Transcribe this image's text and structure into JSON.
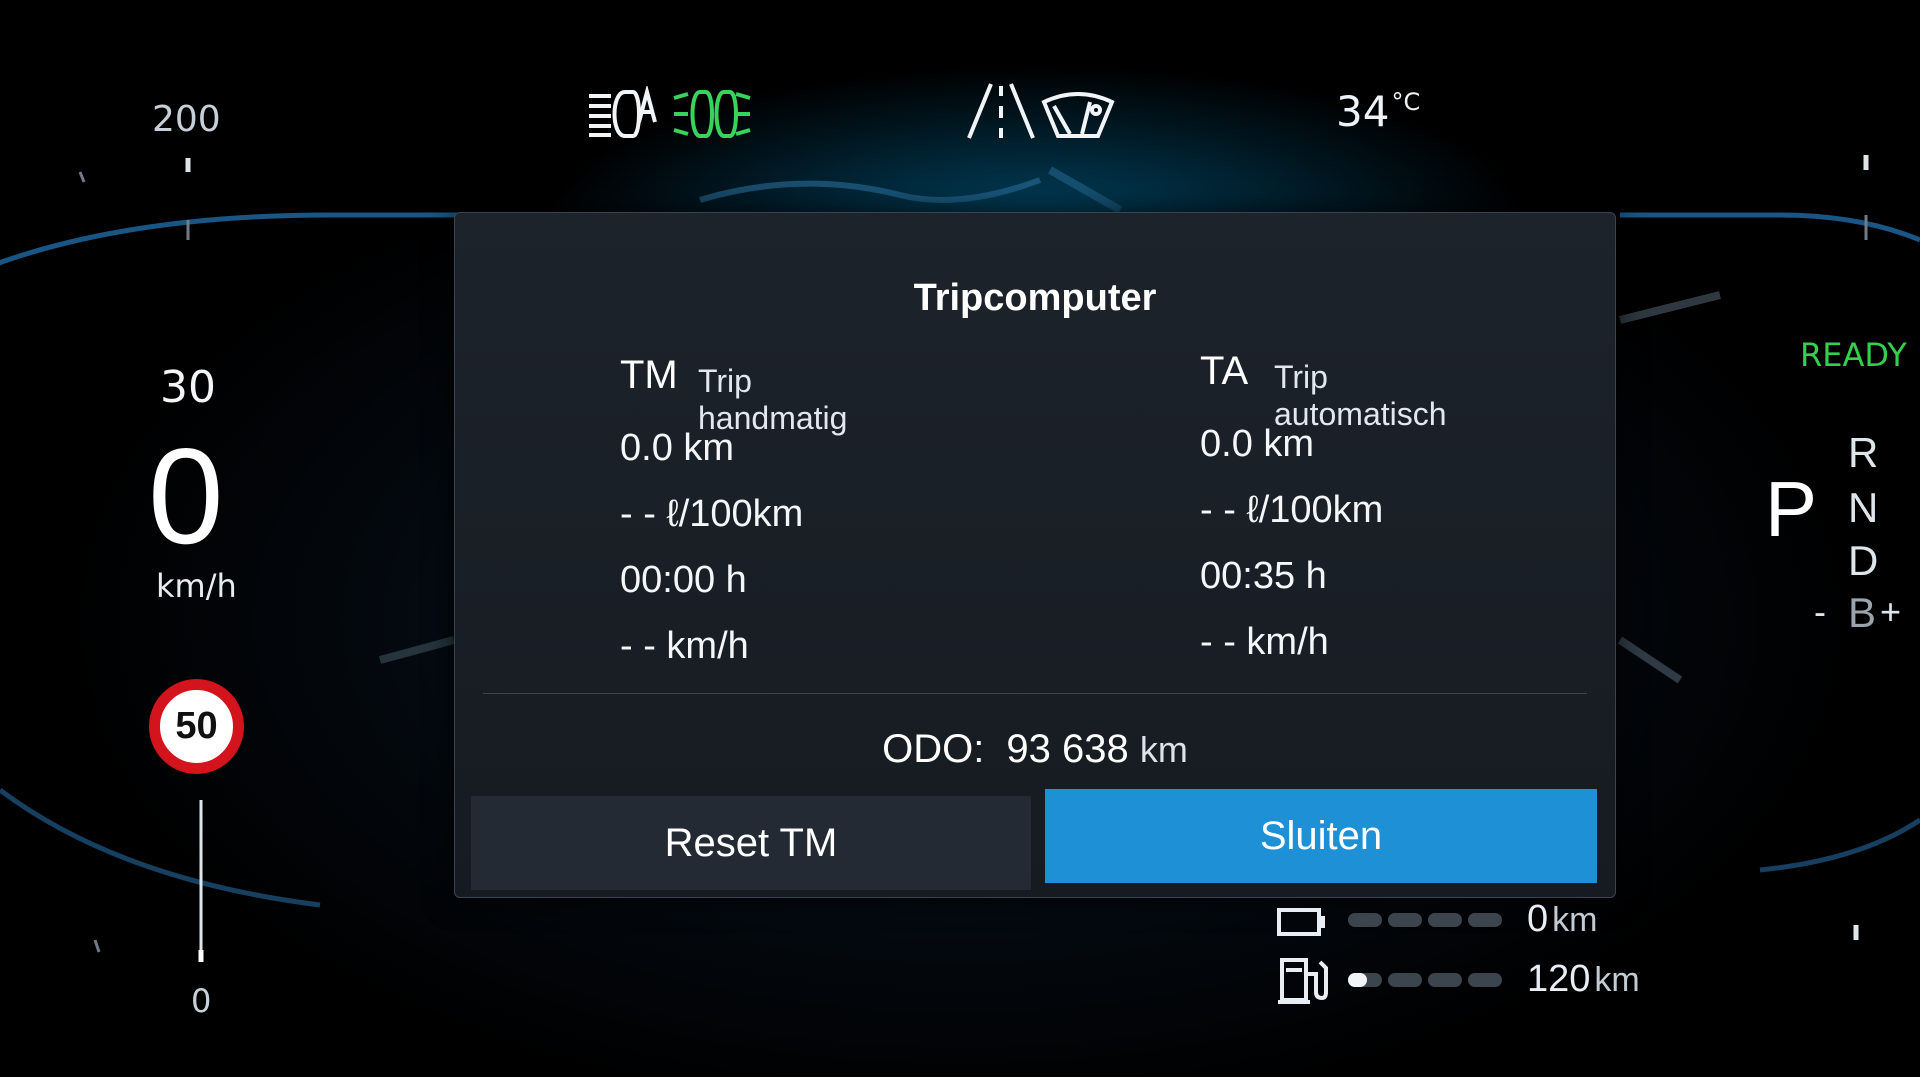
{
  "status_icons": {
    "left_group": [
      "auto-high-beam-icon",
      "parking-lights-icon"
    ],
    "right_group": [
      "lane-assist-icon",
      "wiper-auto-icon"
    ],
    "parking_lights_color": "#38d35a"
  },
  "temperature": {
    "value": "34",
    "unit": "°C"
  },
  "speedometer": {
    "scale_top": "200",
    "scale_bottom": "0",
    "secondary_value": "30",
    "speed": "0",
    "unit": "km/h",
    "speed_limit": "50"
  },
  "drivetrain": {
    "ready_label": "READY",
    "ready_color": "#33d04c",
    "current_gear": "P",
    "gears": [
      "R",
      "N",
      "D"
    ],
    "b_mode": {
      "minus": "-",
      "label": "B",
      "plus": "+"
    }
  },
  "trip_dialog": {
    "title": "Tripcomputer",
    "tm": {
      "abbr": "TM",
      "name": "Trip handmatig",
      "distance": "0.0 km",
      "consumption": "- - ℓ/100km",
      "time": "00:00 h",
      "avg_speed": "- - km/h"
    },
    "ta": {
      "abbr": "TA",
      "name": "Trip automatisch",
      "distance": "0.0 km",
      "consumption": "- - ℓ/100km",
      "time": "00:35 h",
      "avg_speed": "- - km/h"
    },
    "odo": {
      "label": "ODO:",
      "value": "93 638",
      "unit": "km"
    },
    "buttons": {
      "reset": "Reset TM",
      "close": "Sluiten"
    },
    "accent_color": "#1d90d6"
  },
  "range": {
    "electric": {
      "icon": "battery-icon",
      "value": "0",
      "unit": "km",
      "level": 0.0
    },
    "fuel": {
      "icon": "fuel-pump-icon",
      "value": "120",
      "unit": "km",
      "level": 0.12
    }
  }
}
